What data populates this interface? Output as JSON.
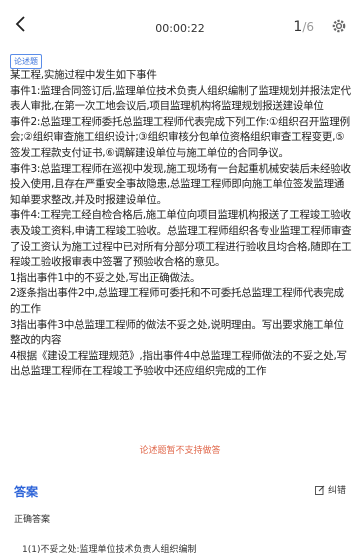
{
  "topbar": {
    "timer": "00:00:22",
    "page_current": "1",
    "page_sep": "/",
    "page_total": "6"
  },
  "question": {
    "tag": "论述题",
    "lines": [
      "某工程,实施过程中发生如下事件",
      "事件1:监理合同签订后,监理单位技术负责人组织编制了监理规划并报法定代表人审批,在第一次工地会议后,项目监理机构将监理规划报送建设单位",
      "事件2:总监理工程师委托总监理工程师代表完成下列工作:①组织召开监理例会;②组织审查施工组织设计;③组织审核分包单位资格组织审查工程变更,⑤签发工程款支付证书,⑥调解建设单位与施工单位的合同争议。",
      "事件3:总监理工程师在巡视中发现,施工现场有一台起重机械安装后未经验收投入使用,且存在严重安全事故隐患,总监理工程师即向施工单位签发监理通知单要求整改,并及时报建设单位。",
      "事件4:工程完工经自检合格后,施工单位向项目监理机构报送了工程竣工验收表及竣工资料,申请工程竣工验收。总监理工程师组织各专业监理工程师审查了设工资认为施工过程中已对所有分部分项工程进行验收且均合格,随即在工程竣工验收报审表中签署了预验收合格的意见。",
      "1指出事件1中的不妥之处,写出正确做法。",
      "2逐条指出事件2中,总监理工程师可委托和不可委托总监理工程师代表完成的工作",
      "3指出事件3中总监理工程师的做法不妥之处,说明理由。写出要求施工单位整改的内容",
      "4根据《建设工程监理规范》,指出事件4中总监理工程师做法的不妥之处,写出总监理工程师在工程竣工予验收中还应组织完成的工作"
    ]
  },
  "notice": "论述题暂不支持做答",
  "answer": {
    "title": "答案",
    "correct_button": "纠错",
    "correct_label": "正确答案",
    "text": "1(1)不妥之处:监理单位技术负责人组织编制"
  },
  "colors": {
    "accent": "#2c63d8",
    "notice": "#e0674a"
  },
  "icons": {
    "back": "chevron-left-icon",
    "settings": "gear-icon",
    "edit": "edit-icon"
  }
}
